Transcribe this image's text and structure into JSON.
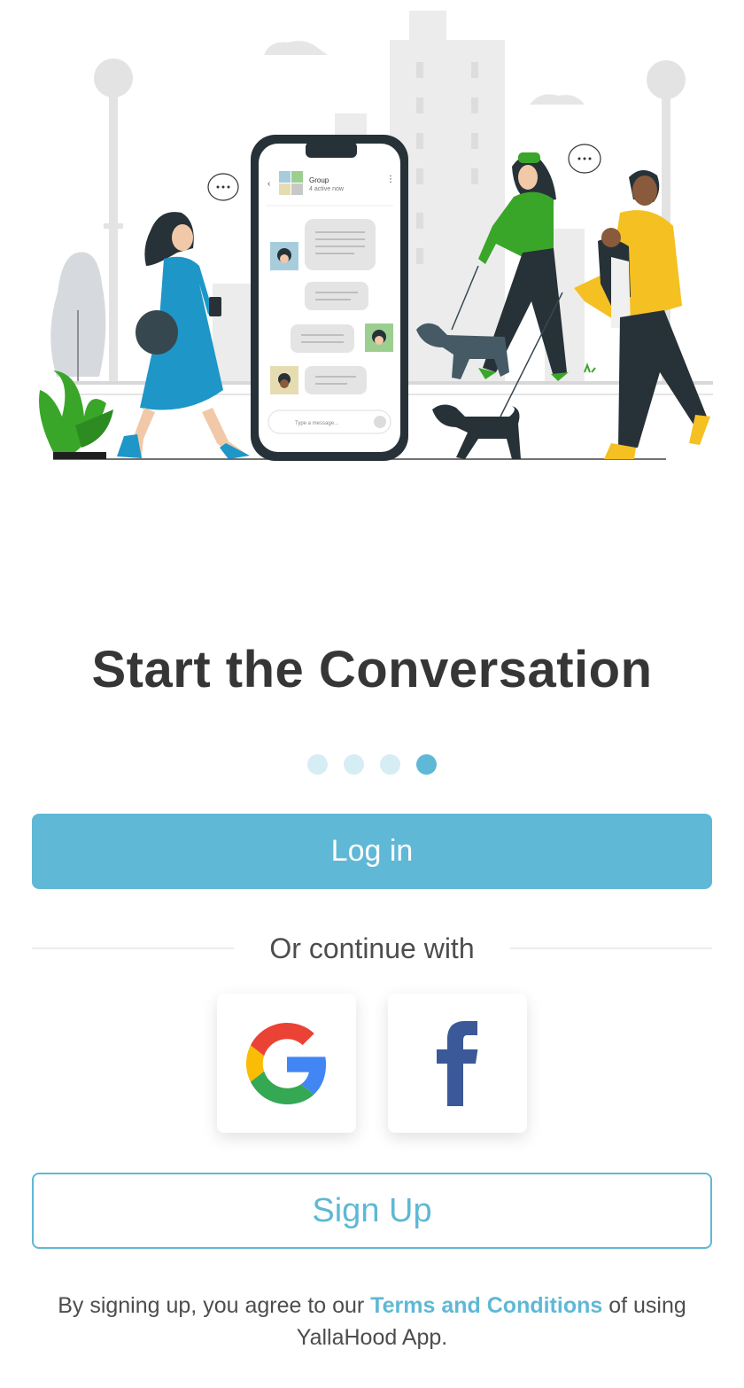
{
  "hero": {
    "phone_chat": {
      "header_title": "Group",
      "header_subtitle": "4 active now",
      "input_placeholder": "Type a message..."
    }
  },
  "title": "Start the Conversation",
  "pager": {
    "total": 4,
    "active_index": 3
  },
  "login_label": "Log in",
  "divider_text": "Or continue with",
  "social": {
    "google": {
      "icon": "google-icon"
    },
    "facebook": {
      "icon": "facebook-icon"
    }
  },
  "signup_label": "Sign Up",
  "terms": {
    "prefix": "By signing up, you agree to our ",
    "link": "Terms and Conditions",
    "suffix": " of using YallaHood App."
  },
  "colors": {
    "accent": "#5fb8d5",
    "accent_light": "#d6edf5",
    "title": "#363636"
  }
}
